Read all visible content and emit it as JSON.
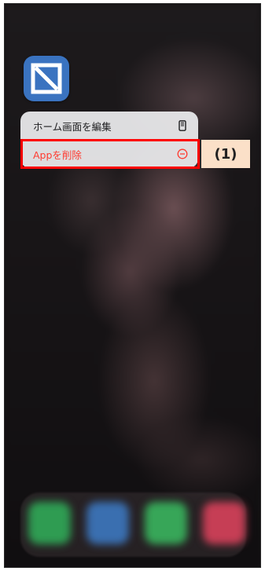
{
  "menu": {
    "edit_home_label": "ホーム画面を編集",
    "delete_app_label": "Appを削除"
  },
  "annotation": {
    "step_label": "(1)"
  },
  "icons": {
    "app_icon": "app-icon",
    "edit_home": "phone-outline-icon",
    "delete": "minus-circle-icon"
  },
  "colors": {
    "menu_background": "#eaeaec",
    "delete_text": "#ff3b30",
    "highlight_border": "#ff0000",
    "callout_background": "#fbe0c8",
    "app_icon_blue": "#3a73c0"
  }
}
